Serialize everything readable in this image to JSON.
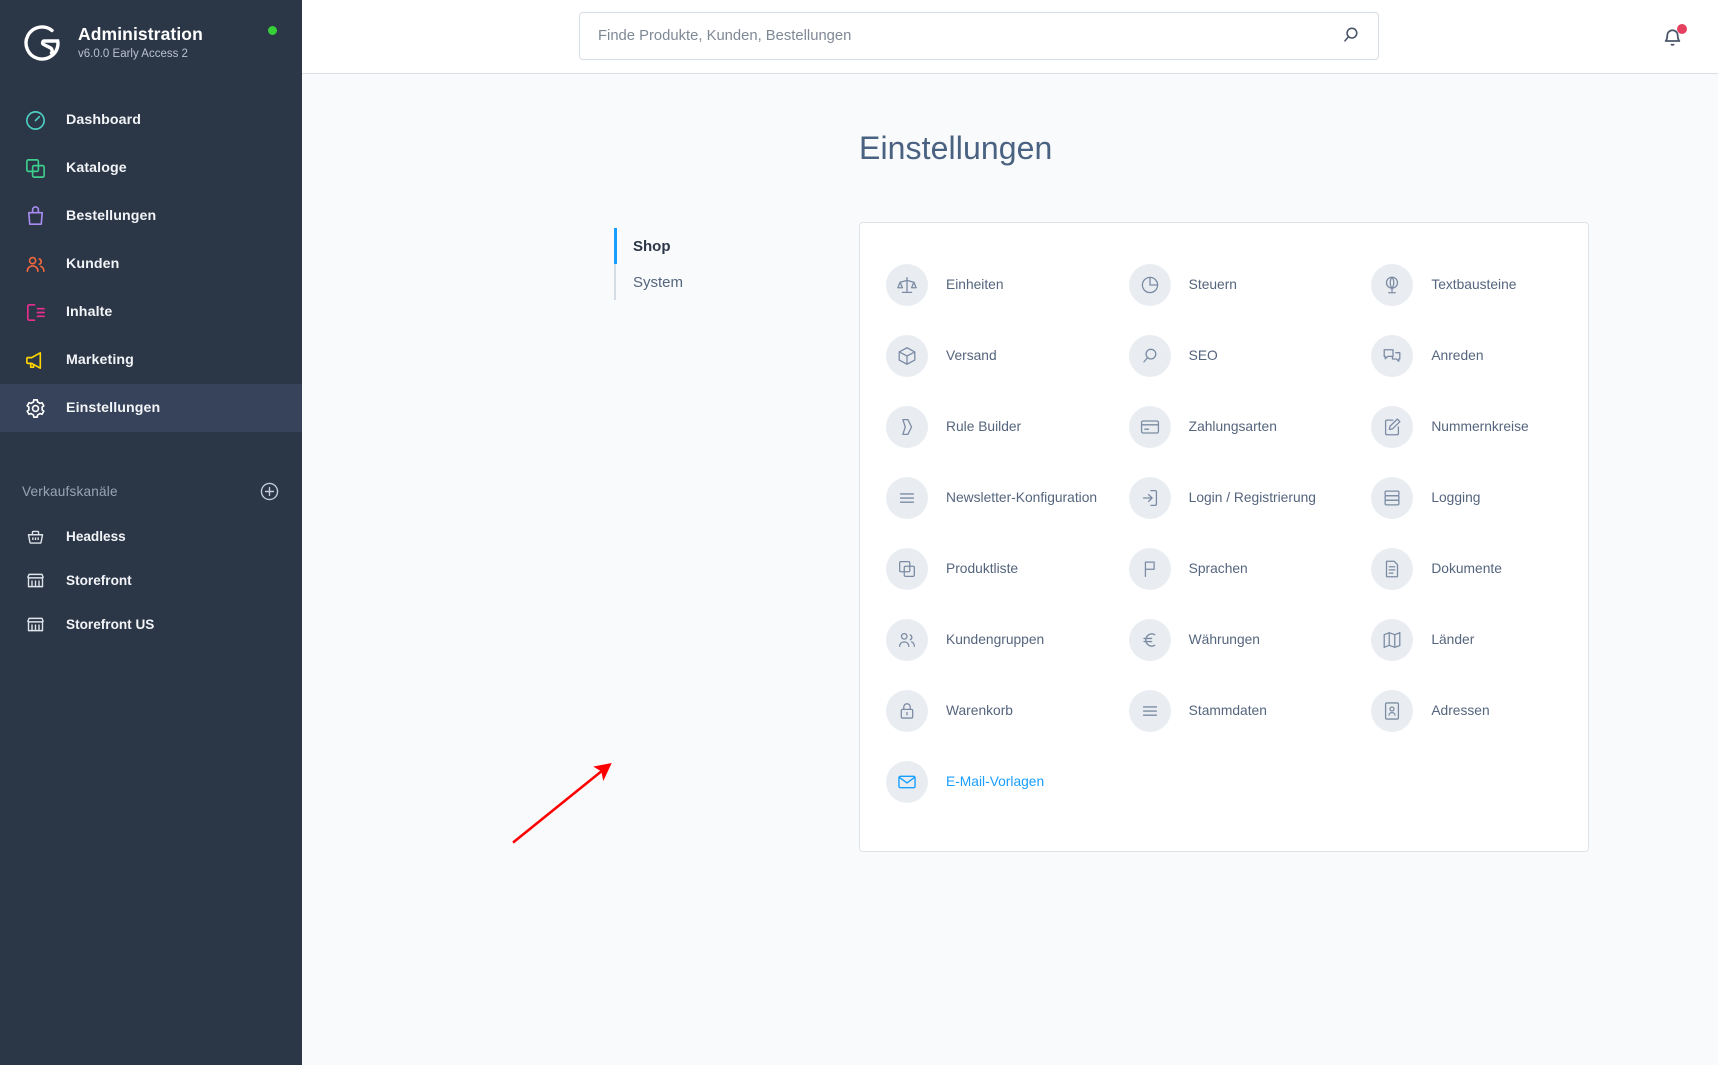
{
  "sidebar": {
    "brand": {
      "title": "Administration",
      "version": "v6.0.0 Early Access 2",
      "status_color": "#37d038"
    },
    "nav": [
      {
        "label": "Dashboard",
        "icon": "speedometer-icon",
        "color": "#4ecfc1",
        "active": false
      },
      {
        "label": "Kataloge",
        "icon": "copy-icon",
        "color": "#3ecf8e",
        "active": false
      },
      {
        "label": "Bestellungen",
        "icon": "bag-icon",
        "color": "#a98cf0",
        "active": false
      },
      {
        "label": "Kunden",
        "icon": "users-icon",
        "color": "#f0683c",
        "active": false
      },
      {
        "label": "Inhalte",
        "icon": "content-icon",
        "color": "#ea2e8e",
        "active": false
      },
      {
        "label": "Marketing",
        "icon": "megaphone-icon",
        "color": "#ffd600",
        "active": false
      },
      {
        "label": "Einstellungen",
        "icon": "gear-icon",
        "color": "#ffffff",
        "active": true
      }
    ],
    "sales_channels": {
      "title": "Verkaufskanäle",
      "add_label": "plus-circle-icon",
      "items": [
        {
          "label": "Headless",
          "icon": "basket-icon"
        },
        {
          "label": "Storefront",
          "icon": "storefront-icon"
        },
        {
          "label": "Storefront US",
          "icon": "storefront-icon"
        }
      ]
    }
  },
  "topbar": {
    "search": {
      "value": "",
      "placeholder": "Finde Produkte, Kunden, Bestellungen",
      "icon": "search-icon"
    },
    "notifications": {
      "icon": "bell-icon",
      "has_badge": true,
      "badge_color": "#e5405e"
    }
  },
  "page": {
    "title": "Einstellungen"
  },
  "tabs": [
    {
      "label": "Shop",
      "active": true
    },
    {
      "label": "System",
      "active": false
    }
  ],
  "settings_grid": {
    "items": [
      {
        "label": "Einheiten",
        "icon": "scales-icon",
        "highlight": false
      },
      {
        "label": "Steuern",
        "icon": "pie-chart-icon",
        "highlight": false
      },
      {
        "label": "Textbausteine",
        "icon": "globe-stand-icon",
        "highlight": false
      },
      {
        "label": "Versand",
        "icon": "package-icon",
        "highlight": false
      },
      {
        "label": "SEO",
        "icon": "magnifier-icon",
        "highlight": false
      },
      {
        "label": "Anreden",
        "icon": "chat-bubbles-icon",
        "highlight": false
      },
      {
        "label": "Rule Builder",
        "icon": "rule-shape-icon",
        "highlight": false
      },
      {
        "label": "Zahlungsarten",
        "icon": "credit-card-icon",
        "highlight": false
      },
      {
        "label": "Nummernkreise",
        "icon": "edit-doc-icon",
        "highlight": false
      },
      {
        "label": "Newsletter-Konfiguration",
        "icon": "list-lines-icon",
        "highlight": false
      },
      {
        "label": "Login / Registrierung",
        "icon": "login-arrow-icon",
        "highlight": false
      },
      {
        "label": "Logging",
        "icon": "database-icon",
        "highlight": false
      },
      {
        "label": "Produktliste",
        "icon": "duplicate-icon",
        "highlight": false
      },
      {
        "label": "Sprachen",
        "icon": "flag-icon",
        "highlight": false
      },
      {
        "label": "Dokumente",
        "icon": "document-icon",
        "highlight": false
      },
      {
        "label": "Kundengruppen",
        "icon": "group-icon",
        "highlight": false
      },
      {
        "label": "Währungen",
        "icon": "euro-icon",
        "highlight": false
      },
      {
        "label": "Länder",
        "icon": "map-icon",
        "highlight": false
      },
      {
        "label": "Warenkorb",
        "icon": "lock-icon",
        "highlight": false
      },
      {
        "label": "Stammdaten",
        "icon": "list-lines-icon",
        "highlight": false
      },
      {
        "label": "Adressen",
        "icon": "address-card-icon",
        "highlight": false
      },
      {
        "label": "E-Mail-Vorlagen",
        "icon": "envelope-icon",
        "highlight": true
      }
    ]
  },
  "annotation": {
    "type": "arrow",
    "color": "#ff0000",
    "points_to": "E-Mail-Vorlagen"
  }
}
